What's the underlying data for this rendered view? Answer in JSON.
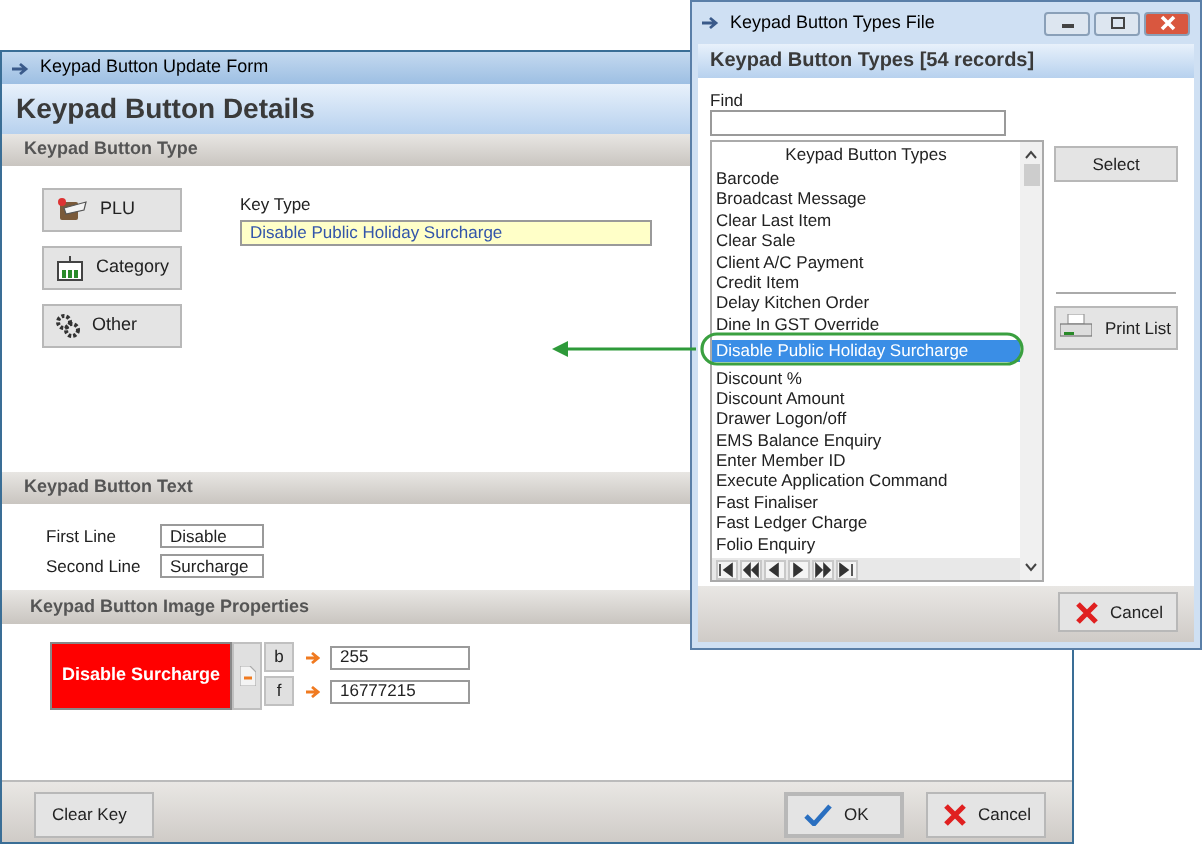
{
  "update_form": {
    "title": "Keypad Button Update Form",
    "header": "Keypad Button Details",
    "type_section": {
      "title": "Keypad Button Type",
      "buttons": [
        {
          "label": "PLU"
        },
        {
          "label": "Category"
        },
        {
          "label": "Other"
        }
      ],
      "key_type": {
        "label": "Key Type",
        "value": "Disable Public Holiday Surcharge"
      }
    },
    "text_section": {
      "title": "Keypad Button Text",
      "fields": [
        {
          "label": "First Line",
          "value": "Disable"
        },
        {
          "label": "Second Line",
          "value": "Surcharge"
        }
      ]
    },
    "image_section": {
      "title": "Keypad Button Image Properties",
      "preview": "Disable Surcharge",
      "colors": [
        {
          "label": "b",
          "value": "255"
        },
        {
          "label": "f",
          "value": "16777215"
        }
      ]
    },
    "footer_buttons": [
      {
        "label": "Clear Key"
      },
      {
        "label": "OK"
      },
      {
        "label": "Cancel"
      }
    ]
  },
  "types_window": {
    "title": "Keypad Button Types File",
    "header": "Keypad Button Types [54 records]",
    "find": {
      "label": "Find"
    },
    "list_header": "Keypad Button Types",
    "items": [
      {
        "label": "Barcode",
        "selected": false
      },
      {
        "label": "Broadcast Message",
        "selected": false
      },
      {
        "label": "Clear Last Item",
        "selected": false
      },
      {
        "label": "Clear Sale",
        "selected": false
      },
      {
        "label": "Client A/C Payment",
        "selected": false
      },
      {
        "label": "Credit Item",
        "selected": false
      },
      {
        "label": "Delay Kitchen Order",
        "selected": false
      },
      {
        "label": "Dine In GST Override",
        "selected": false
      },
      {
        "label": "Disable Public Holiday Surcharge",
        "selected": true
      },
      {
        "label": "Discount %",
        "selected": false
      },
      {
        "label": "Discount Amount",
        "selected": false
      },
      {
        "label": "Drawer Logon/off",
        "selected": false
      },
      {
        "label": "EMS Balance Enquiry",
        "selected": false
      },
      {
        "label": "Enter Member ID",
        "selected": false
      },
      {
        "label": "Execute Application Command",
        "selected": false
      },
      {
        "label": "Fast Finaliser",
        "selected": false
      },
      {
        "label": "Fast Ledger Charge",
        "selected": false
      },
      {
        "label": "Folio Enquiry",
        "selected": false
      }
    ],
    "side_buttons": [
      {
        "label": "Select"
      },
      {
        "label": "Print List"
      }
    ],
    "footer_buttons": [
      {
        "label": "Cancel"
      }
    ]
  }
}
